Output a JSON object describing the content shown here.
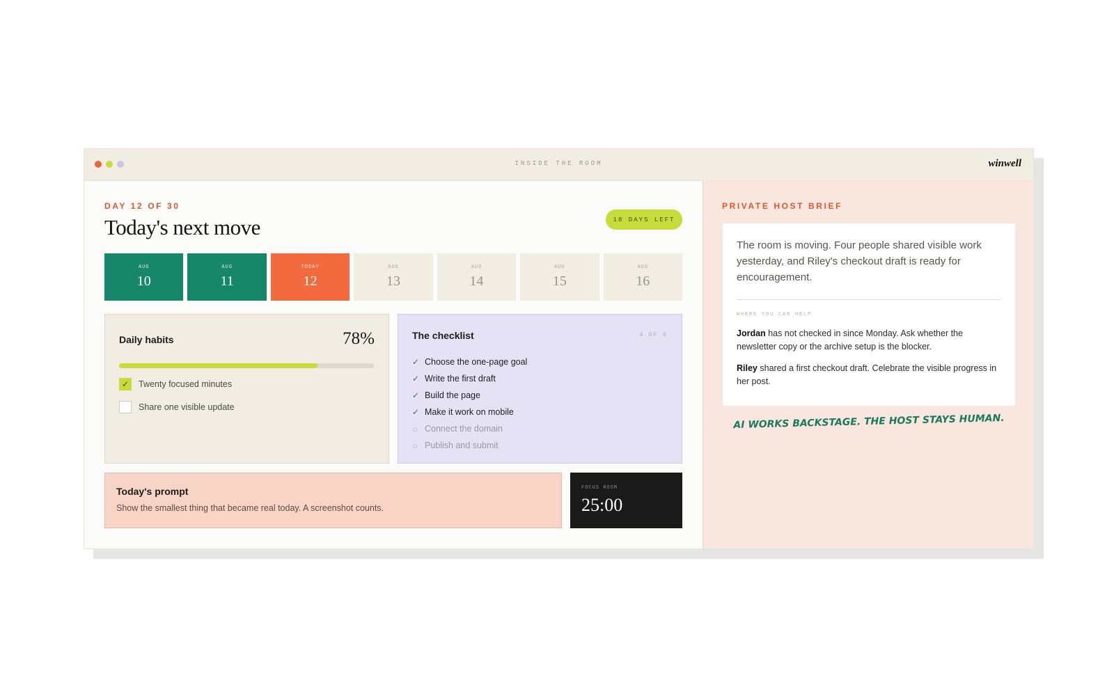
{
  "window": {
    "title": "INSIDE THE ROOM",
    "brand": "winwell",
    "dots": [
      "#f0623c",
      "#c6dc3b",
      "#c9c2ec"
    ]
  },
  "main": {
    "kicker": "DAY 12 OF 30",
    "headline": "Today's next move",
    "days_left": "18 DAYS LEFT",
    "days": [
      {
        "month": "AUG",
        "day": "10",
        "state": "done"
      },
      {
        "month": "AUG",
        "day": "11",
        "state": "done"
      },
      {
        "month": "TODAY",
        "day": "12",
        "state": "today"
      },
      {
        "month": "AUG",
        "day": "13",
        "state": "upcoming"
      },
      {
        "month": "AUG",
        "day": "14",
        "state": "upcoming"
      },
      {
        "month": "AUG",
        "day": "15",
        "state": "upcoming"
      },
      {
        "month": "AUG",
        "day": "16",
        "state": "upcoming"
      }
    ],
    "habits": {
      "title": "Daily habits",
      "percent_label": "78%",
      "progress": 0.78,
      "items": [
        {
          "label": "Twenty focused minutes",
          "checked": true
        },
        {
          "label": "Share one visible update",
          "checked": false
        }
      ]
    },
    "checklist": {
      "title": "The checklist",
      "count": "4 OF 6",
      "items": [
        {
          "label": "Choose the one-page goal",
          "done": true
        },
        {
          "label": "Write the first draft",
          "done": true
        },
        {
          "label": "Build the page",
          "done": true
        },
        {
          "label": "Make it work on mobile",
          "done": true
        },
        {
          "label": "Connect the domain",
          "done": false
        },
        {
          "label": "Publish and submit",
          "done": false
        }
      ]
    },
    "prompt": {
      "title": "Today's prompt",
      "text": "Show the smallest thing that became real today. A screenshot counts."
    },
    "timer": {
      "label": "FOCUS ROOM",
      "value": "25:00"
    }
  },
  "side": {
    "kicker": "PRIVATE HOST BRIEF",
    "lead": "The room is moving. Four people shared visible work yesterday, and Riley's checkout draft is ready for encouragement.",
    "help_label": "WHERE YOU CAN HELP",
    "notes": [
      {
        "name": "Jordan",
        "text": " has not checked in since Monday. Ask whether the newsletter copy or the archive setup is the blocker."
      },
      {
        "name": "Riley",
        "text": " shared a first checkout draft. Celebrate the visible progress in her post."
      }
    ],
    "tagline": "AI WORKS BACKSTAGE. THE HOST STAYS HUMAN."
  },
  "colors": {
    "done": "#17876a",
    "today": "#f26a3d",
    "upcoming": "#f2ede2",
    "accent": "#c6dc3b"
  }
}
